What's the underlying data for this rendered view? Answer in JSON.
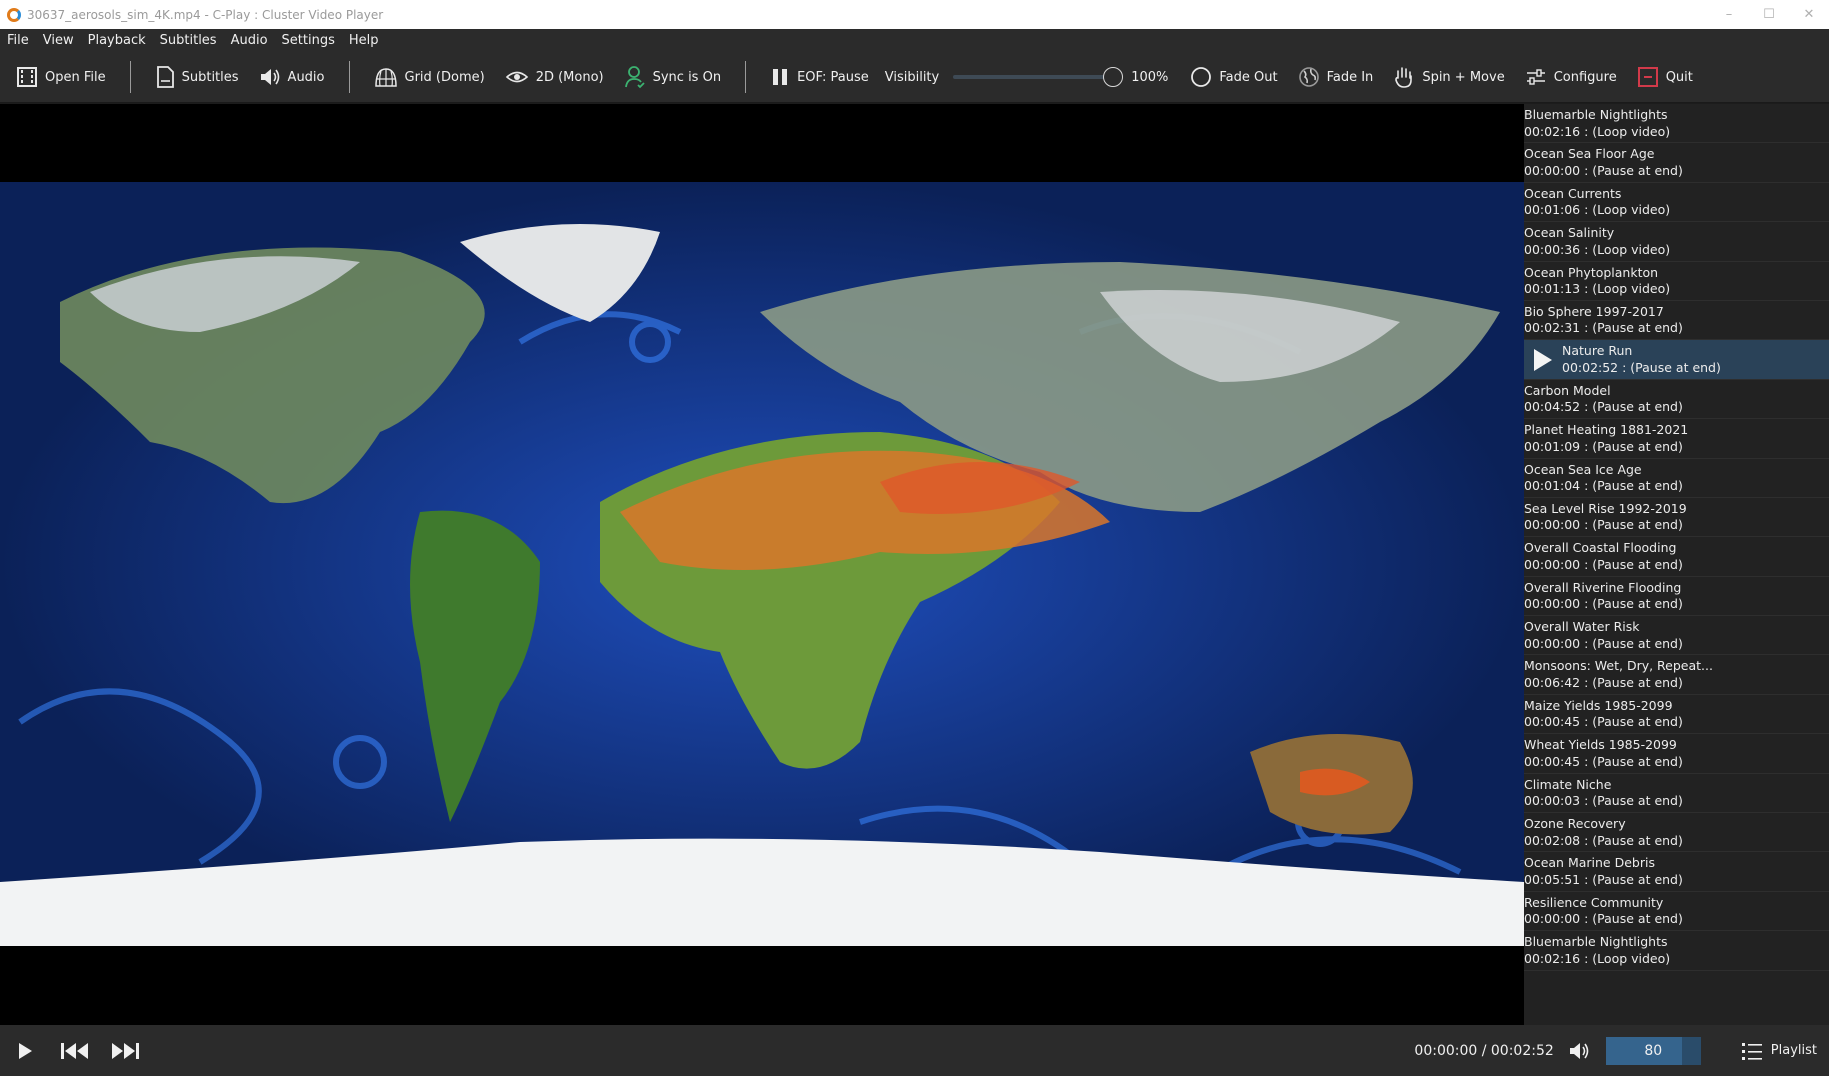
{
  "window": {
    "title": "30637_aerosols_sim_4K.mp4 - C-Play : Cluster Video Player",
    "minimize": "–",
    "maximize": "☐",
    "close": "✕"
  },
  "menu": [
    "File",
    "View",
    "Playback",
    "Subtitles",
    "Audio",
    "Settings",
    "Help"
  ],
  "toolbar": {
    "open_file": "Open File",
    "subtitles": "Subtitles",
    "audio": "Audio",
    "grid": "Grid (Dome)",
    "mono": "2D (Mono)",
    "sync": "Sync is On",
    "eof": "EOF: Pause",
    "visibility_label": "Visibility",
    "visibility_value": "100%",
    "visibility_level": 1.0,
    "fade_out": "Fade Out",
    "fade_in": "Fade In",
    "spin_move": "Spin + Move",
    "configure": "Configure",
    "quit": "Quit"
  },
  "colors": {
    "accent": "#2a4258",
    "sync_icon": "#3cb371",
    "quit_icon": "#d23a4a",
    "ocean": "#0e2a66"
  },
  "playlist": [
    {
      "title": "Bluemarble Nightlights",
      "sub": "00:02:16 : (Loop video)"
    },
    {
      "title": "Ocean Sea Floor Age",
      "sub": "00:00:00 : (Pause at end)"
    },
    {
      "title": "Ocean Currents",
      "sub": "00:01:06 : (Loop video)"
    },
    {
      "title": "Ocean Salinity",
      "sub": "00:00:36 : (Loop video)"
    },
    {
      "title": "Ocean Phytoplankton",
      "sub": "00:01:13 : (Loop video)"
    },
    {
      "title": "Bio Sphere 1997-2017",
      "sub": "00:02:31 : (Pause at end)"
    },
    {
      "title": "Nature Run",
      "sub": "00:02:52 : (Pause at end)",
      "active": true
    },
    {
      "title": "Carbon Model",
      "sub": "00:04:52 : (Pause at end)"
    },
    {
      "title": "Planet Heating 1881-2021",
      "sub": "00:01:09 : (Pause at end)"
    },
    {
      "title": "Ocean Sea Ice Age",
      "sub": "00:01:04 : (Pause at end)"
    },
    {
      "title": "Sea Level Rise 1992-2019",
      "sub": "00:00:00 : (Pause at end)"
    },
    {
      "title": "Overall Coastal Flooding",
      "sub": "00:00:00 : (Pause at end)"
    },
    {
      "title": "Overall Riverine Flooding",
      "sub": "00:00:00 : (Pause at end)"
    },
    {
      "title": "Overall Water Risk",
      "sub": "00:00:00 : (Pause at end)"
    },
    {
      "title": "Monsoons: Wet, Dry, Repeat...",
      "sub": "00:06:42 : (Pause at end)"
    },
    {
      "title": "Maize Yields 1985-2099",
      "sub": "00:00:45 : (Pause at end)"
    },
    {
      "title": "Wheat Yields 1985-2099",
      "sub": "00:00:45 : (Pause at end)"
    },
    {
      "title": "Climate Niche",
      "sub": "00:00:03 : (Pause at end)"
    },
    {
      "title": "Ozone Recovery",
      "sub": "00:02:08 : (Pause at end)"
    },
    {
      "title": "Ocean Marine Debris",
      "sub": "00:05:51 : (Pause at end)"
    },
    {
      "title": "Resilience Community",
      "sub": "00:00:00 : (Pause at end)"
    },
    {
      "title": "Bluemarble Nightlights",
      "sub": "00:02:16 : (Loop video)"
    }
  ],
  "controls": {
    "time": "00:00:00 / 00:02:52",
    "volume": "80",
    "volume_level": 0.8,
    "playlist_label": "Playlist"
  }
}
